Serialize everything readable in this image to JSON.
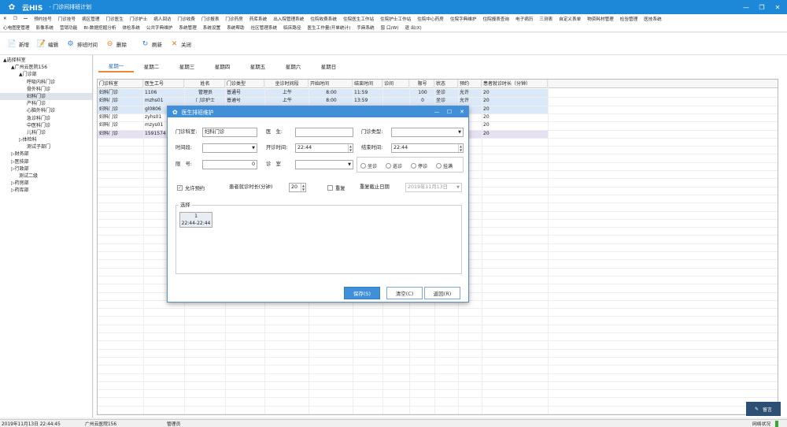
{
  "app": {
    "name": "云HIS",
    "window_title": "- 门诊间排班计划"
  },
  "menu1": [
    "预约挂号",
    "门诊挂号",
    "病区管理",
    "门诊医生",
    "门诊护士",
    "病人回访",
    "门诊收费",
    "门诊报表",
    "门诊药房",
    "药库系统",
    "出入院管理系统",
    "住院收费系统",
    "住院医生工作站",
    "住院护士工作站",
    "住院中心药房",
    "住院字典维护",
    "住院报表查询",
    "电子病历",
    "三测表",
    "自定义表单",
    "物资耗材管理",
    "检验管理",
    "医技系统"
  ],
  "menu2": [
    "心电图室管理",
    "影像系统",
    "营销功能",
    "BI-数据挖掘分析",
    "体检系统",
    "公共字典维护",
    "系统管理",
    "系统设置",
    "系统帮助",
    "社区管理系统",
    "临床路径",
    "医生工作量(开单统计)",
    "手麻系统",
    "窗 口(W)",
    "退 出(X)"
  ],
  "toolbar": [
    {
      "label": "新增",
      "icon": "new-icon"
    },
    {
      "label": "编辑",
      "icon": "edit-icon"
    },
    {
      "label": "排班时间",
      "icon": "gear-icon"
    },
    {
      "label": "删除",
      "icon": "delete-icon"
    },
    {
      "label": "刷新",
      "icon": "refresh-icon"
    },
    {
      "label": "关闭",
      "icon": "close-icon"
    }
  ],
  "tree": [
    {
      "label": "▲选择科室",
      "indent": 0,
      "selected": false
    },
    {
      "label": "▲广州云医院156",
      "indent": 1,
      "selected": false
    },
    {
      "label": "▲门诊部",
      "indent": 2,
      "selected": false
    },
    {
      "label": "呼吸内科门诊",
      "indent": 3,
      "selected": false
    },
    {
      "label": "骨外科门诊",
      "indent": 3,
      "selected": false
    },
    {
      "label": "妇科门诊",
      "indent": 3,
      "selected": true
    },
    {
      "label": "产科门诊",
      "indent": 3,
      "selected": false
    },
    {
      "label": "心脑外科门诊",
      "indent": 3,
      "selected": false
    },
    {
      "label": "急诊科门诊",
      "indent": 3,
      "selected": false
    },
    {
      "label": "中医科门诊",
      "indent": 3,
      "selected": false
    },
    {
      "label": "儿科门诊",
      "indent": 3,
      "selected": false
    },
    {
      "label": "▷体检科",
      "indent": 2,
      "selected": false
    },
    {
      "label": "测试子部门",
      "indent": 3,
      "selected": false
    },
    {
      "label": "▷财务部",
      "indent": 1,
      "selected": false
    },
    {
      "label": "▷医技部",
      "indent": 1,
      "selected": false
    },
    {
      "label": "▷行政部",
      "indent": 1,
      "selected": false
    },
    {
      "label": "测试二级",
      "indent": 2,
      "selected": false
    },
    {
      "label": "▷药房部",
      "indent": 1,
      "selected": false
    },
    {
      "label": "▷药库部",
      "indent": 1,
      "selected": false
    }
  ],
  "tabs": [
    "星期一",
    "星期二",
    "星期三",
    "星期四",
    "星期五",
    "星期六",
    "星期日"
  ],
  "grid": {
    "columns": [
      "门诊科室",
      "医生工号",
      "姓名",
      "门诊类型",
      "坐诊时间段",
      "开始时间",
      "结束时间",
      "诊间",
      "限号",
      "状态",
      "预约",
      "患者就诊时长（分钟）"
    ],
    "rows": [
      [
        "妇科门诊",
        "1106",
        "管理员",
        "普通号",
        "上午",
        "8:00",
        "11:59",
        "",
        "100",
        "坐诊",
        "允许",
        "20"
      ],
      [
        "妇科门诊",
        "mzhs01",
        "门诊护士",
        "普通号",
        "上午",
        "8:00",
        "13:59",
        "",
        "0",
        "坐诊",
        "允许",
        "20"
      ],
      [
        "妇科门诊",
        "gl0806",
        "",
        "",
        "",
        "",
        "",
        "",
        "",
        "",
        "",
        "20"
      ],
      [
        "妇科门诊",
        "zyhs01",
        "",
        "",
        "",
        "",
        "",
        "",
        "",
        "",
        "",
        "20"
      ],
      [
        "妇科门诊",
        "mzys01",
        "",
        "",
        "",
        "",
        "",
        "",
        "",
        "",
        "",
        "20"
      ],
      [
        "妇科门诊",
        "1591574",
        "",
        "",
        "",
        "",
        "",
        "",
        "",
        "",
        "",
        "20"
      ]
    ],
    "row_colors": [
      "#dbe8f7",
      "#dbe8f7",
      "#dbe8f7",
      "#ffffff",
      "#ffffff",
      "#e5e0f2"
    ]
  },
  "dialog": {
    "title": "医生排班维护",
    "dept_label": "门诊科室:",
    "dept_value": "妇科门诊",
    "doctor_label": "医　生:",
    "doctor_value": "",
    "type_label": "门诊类型:",
    "type_value": "",
    "period_label": "时间段:",
    "period_value": "",
    "start_label": "开诊时间:",
    "start_value": "22:44",
    "end_label": "结束时间:",
    "end_value": "22:44",
    "limit_label": "限　号:",
    "limit_value": "0",
    "room_label": "诊　室",
    "room_value": "",
    "status_options": [
      "坐诊",
      "巡诊",
      "停诊",
      "挂满"
    ],
    "allow_booking_label": "允许预约",
    "allow_booking_checked": true,
    "duration_label": "患者就诊时长(分钟)",
    "duration_value": "20",
    "repeat_label": "重复",
    "repeat_checked": false,
    "repeat_end_label": "重复截止日期",
    "repeat_end_value": "2019年11月13日",
    "select_caption": "选择",
    "slot_index": "1",
    "slot_time": "22:44-22:44",
    "save_label": "保存(S)",
    "clear_label": "清空(C)",
    "back_label": "返回(R)"
  },
  "status": {
    "datetime": "2019年11月13日 22:44:45",
    "hospital": "广州云医院156",
    "user": "管理员",
    "network": "网络状况"
  },
  "message_button": "留言",
  "colors": {
    "titlebar": "#1e88d8",
    "accent_tab": "#e98a3a",
    "primary_button": "#3f8fd9"
  }
}
